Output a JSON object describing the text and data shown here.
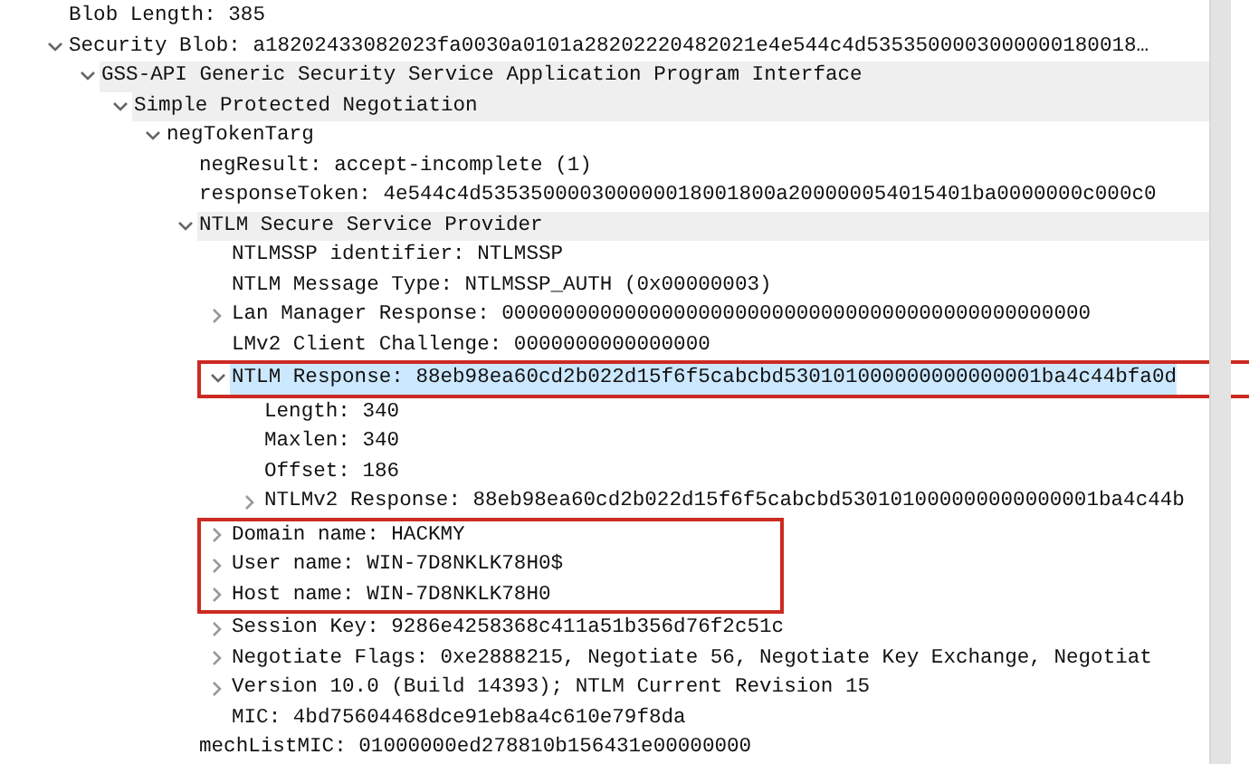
{
  "tree": [
    {
      "label": "Blob Length: 385",
      "selected": false,
      "shaded": false,
      "boxed": false
    },
    {
      "label": "Security Blob: a18202433082023fa0030a0101a28202220482021e4e544c4d5353500003000000180018…",
      "expanded": true,
      "selected": false,
      "shaded": false,
      "boxed": false,
      "children": [
        {
          "label": "GSS-API Generic Security Service Application Program Interface",
          "expanded": true,
          "selected": false,
          "shaded": true,
          "boxed": false,
          "children": [
            {
              "label": "Simple Protected Negotiation",
              "expanded": true,
              "selected": false,
              "shaded": true,
              "boxed": false,
              "children": [
                {
                  "label": "negTokenTarg",
                  "expanded": true,
                  "selected": false,
                  "shaded": false,
                  "boxed": false,
                  "children": [
                    {
                      "label": "negResult: accept-incomplete (1)",
                      "selected": false,
                      "shaded": false,
                      "boxed": false
                    },
                    {
                      "label": "responseToken: 4e544c4d535350000300000018001800a200000054015401ba0000000c000c0",
                      "selected": false,
                      "shaded": false,
                      "boxed": false
                    },
                    {
                      "label": "NTLM Secure Service Provider",
                      "expanded": true,
                      "selected": false,
                      "shaded": true,
                      "boxed": false,
                      "children": [
                        {
                          "label": "NTLMSSP identifier: NTLMSSP",
                          "selected": false,
                          "shaded": false,
                          "boxed": false
                        },
                        {
                          "label": "NTLM Message Type: NTLMSSP_AUTH (0x00000003)",
                          "selected": false,
                          "shaded": false,
                          "boxed": false
                        },
                        {
                          "label": "Lan Manager Response: 000000000000000000000000000000000000000000000000",
                          "expanded": false,
                          "selected": false,
                          "shaded": false,
                          "boxed": false
                        },
                        {
                          "label": "LMv2 Client Challenge: 0000000000000000",
                          "selected": false,
                          "shaded": false,
                          "boxed": false
                        },
                        {
                          "label": "NTLM Response: 88eb98ea60cd2b022d15f6f5cabcbd530101000000000000001ba4c44bfa0d",
                          "expanded": true,
                          "selected": true,
                          "shaded": false,
                          "boxed": true,
                          "children": [
                            {
                              "label": "Length: 340",
                              "selected": false,
                              "shaded": false,
                              "boxed": false
                            },
                            {
                              "label": "Maxlen: 340",
                              "selected": false,
                              "shaded": false,
                              "boxed": false
                            },
                            {
                              "label": "Offset: 186",
                              "selected": false,
                              "shaded": false,
                              "boxed": false
                            },
                            {
                              "label": "NTLMv2 Response: 88eb98ea60cd2b022d15f6f5cabcbd530101000000000000001ba4c44b",
                              "expanded": false,
                              "selected": false,
                              "shaded": false,
                              "boxed": false
                            }
                          ]
                        },
                        {
                          "label": "Domain name: HACKMY",
                          "expanded": false,
                          "selected": false,
                          "shaded": false,
                          "boxed": true
                        },
                        {
                          "label": "User name: WIN-7D8NKLK78H0$",
                          "expanded": false,
                          "selected": false,
                          "shaded": false,
                          "boxed": true
                        },
                        {
                          "label": "Host name: WIN-7D8NKLK78H0",
                          "expanded": false,
                          "selected": false,
                          "shaded": false,
                          "boxed": true
                        },
                        {
                          "label": "Session Key: 9286e4258368c411a51b356d76f2c51c",
                          "expanded": false,
                          "selected": false,
                          "shaded": false,
                          "boxed": false
                        },
                        {
                          "label": "Negotiate Flags: 0xe2888215, Negotiate 56, Negotiate Key Exchange, Negotiat",
                          "expanded": false,
                          "selected": false,
                          "shaded": false,
                          "boxed": false
                        },
                        {
                          "label": "Version 10.0 (Build 14393); NTLM Current Revision 15",
                          "expanded": false,
                          "selected": false,
                          "shaded": false,
                          "boxed": false
                        },
                        {
                          "label": "MIC: 4bd75604468dce91eb8a4c610e79f8da",
                          "selected": false,
                          "shaded": false,
                          "boxed": false
                        }
                      ]
                    },
                    {
                      "label": "mechListMIC: 01000000ed278810b156431e00000000",
                      "selected": false,
                      "shaded": false,
                      "boxed": false
                    }
                  ]
                }
              ]
            }
          ]
        }
      ]
    }
  ]
}
